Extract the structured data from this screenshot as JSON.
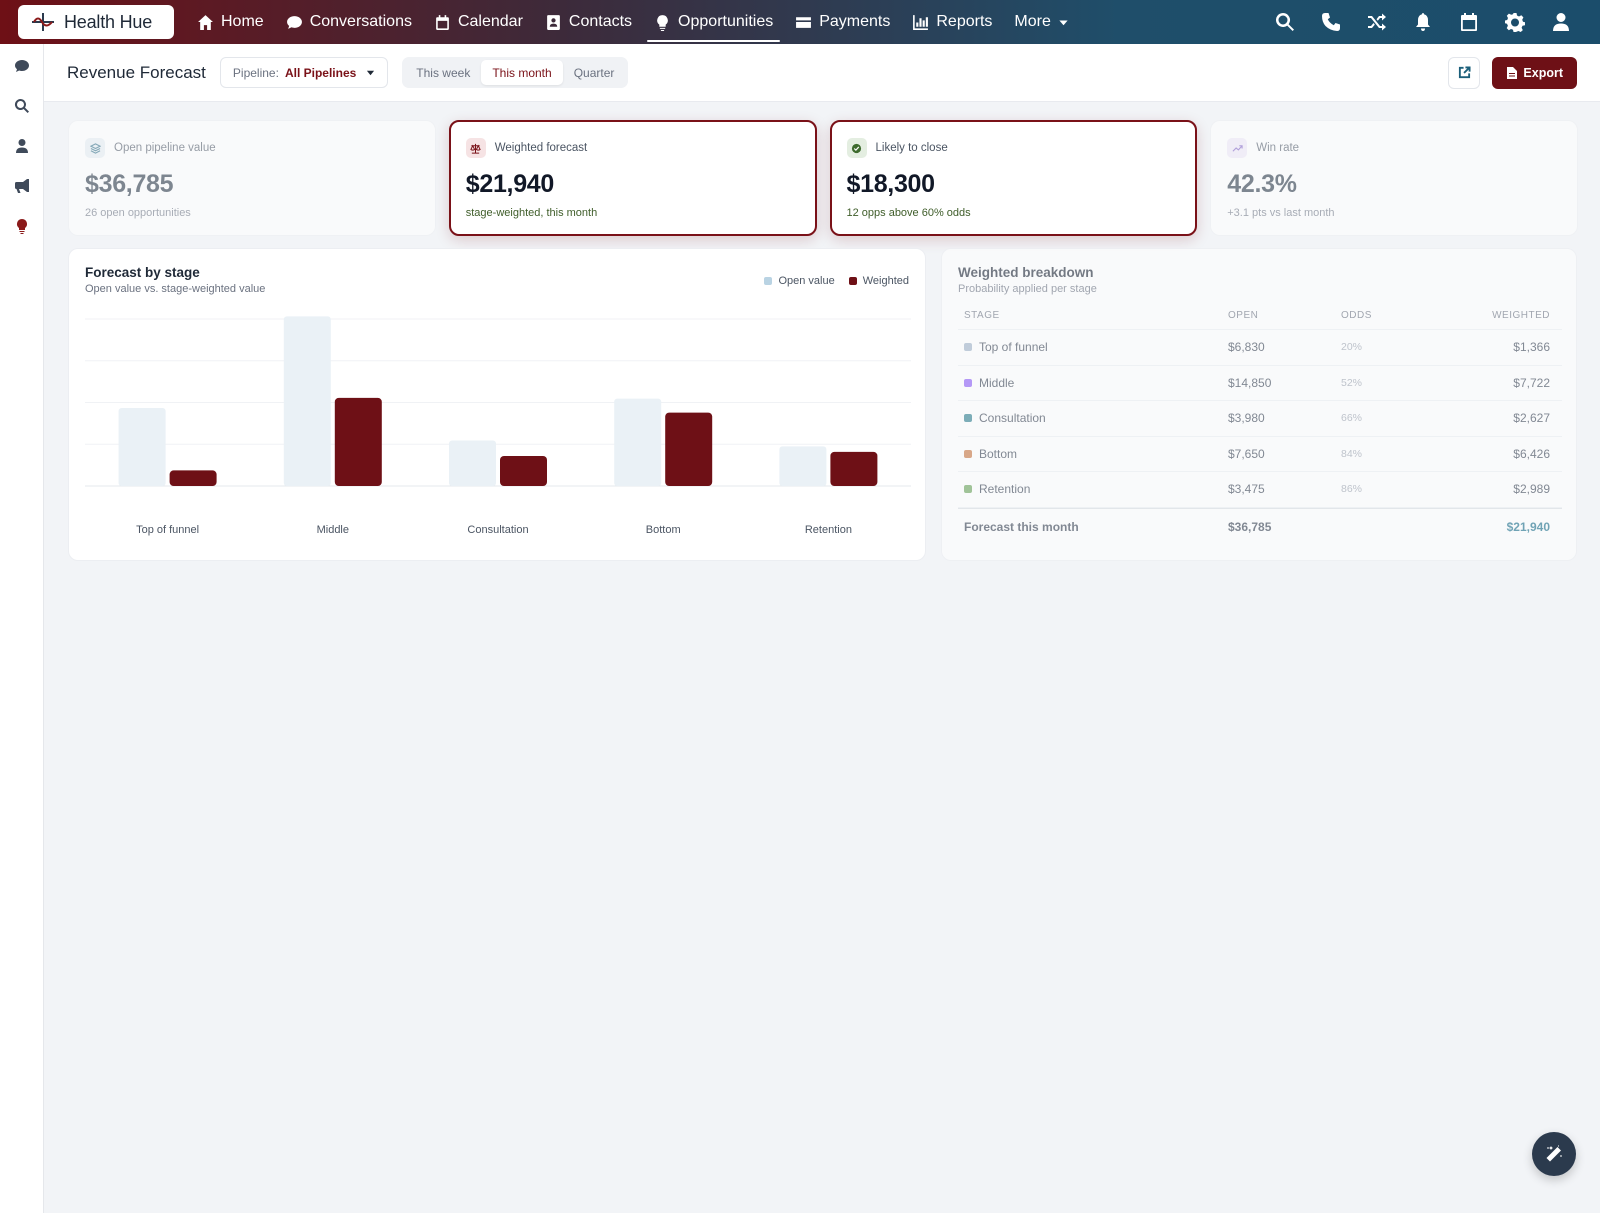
{
  "brand": {
    "name": "Health Hue"
  },
  "nav": {
    "items": [
      {
        "label": "Home",
        "icon": "home-icon"
      },
      {
        "label": "Conversations",
        "icon": "chat-icon"
      },
      {
        "label": "Calendar",
        "icon": "calendar-icon"
      },
      {
        "label": "Contacts",
        "icon": "contacts-icon"
      },
      {
        "label": "Opportunities",
        "icon": "lightbulb-icon",
        "active": true
      },
      {
        "label": "Payments",
        "icon": "credit-card-icon"
      },
      {
        "label": "Reports",
        "icon": "chart-icon"
      },
      {
        "label": "More",
        "icon": "chevron-down-icon"
      }
    ],
    "right_icons": [
      "search-icon",
      "phone-icon",
      "shuffle-icon",
      "bell-icon",
      "calendar-icon",
      "gear-icon",
      "user-icon"
    ]
  },
  "rail": {
    "icons": [
      "chat-icon",
      "search-icon",
      "user-icon",
      "megaphone-icon",
      "lightbulb-icon"
    ]
  },
  "header": {
    "title": "Revenue Forecast",
    "pipeline_label": "Pipeline:",
    "pipeline_value": "All Pipelines",
    "ranges": [
      "This week",
      "This month",
      "Quarter"
    ],
    "active_range": "This month",
    "export_label": "Export"
  },
  "kpis": [
    {
      "label": "Open pipeline value",
      "value": "$36,785",
      "sub": "26 open opportunities",
      "icon": "layers-icon"
    },
    {
      "label": "Weighted forecast",
      "value": "$21,940",
      "sub": "stage-weighted, this month",
      "icon": "scale-icon"
    },
    {
      "label": "Likely to close",
      "value": "$18,300",
      "sub": "12 opps above 60% odds",
      "icon": "check-circle-icon"
    },
    {
      "label": "Win rate",
      "value": "42.3%",
      "sub": "+3.1 pts vs last month",
      "icon": "trend-up-icon"
    }
  ],
  "chart": {
    "title": "Forecast by stage",
    "subtitle": "Open value vs. stage-weighted value",
    "legend": [
      "Open value",
      "Weighted"
    ]
  },
  "chart_data": {
    "type": "bar",
    "categories": [
      "Top of funnel",
      "Middle",
      "Consultation",
      "Bottom",
      "Retention"
    ],
    "series": [
      {
        "name": "Open value",
        "values": [
          6830,
          14850,
          3980,
          7650,
          3475
        ],
        "color": "#eaf1f6"
      },
      {
        "name": "Weighted",
        "values": [
          1366,
          7722,
          2627,
          6426,
          2989
        ],
        "color": "#6e1016"
      }
    ],
    "grid": true,
    "legend": "top-right"
  },
  "breakdown": {
    "title": "Weighted breakdown",
    "subtitle": "Probability applied per stage",
    "columns": [
      "STAGE",
      "OPEN",
      "ODDS",
      "WEIGHTED"
    ],
    "rows": [
      {
        "stage": "Top of funnel",
        "open": "$6,830",
        "odds": "20%",
        "weighted": "$1,366",
        "color": "#9fb3c8"
      },
      {
        "stage": "Middle",
        "open": "$14,850",
        "odds": "52%",
        "weighted": "$7,722",
        "color": "#8b5cf6"
      },
      {
        "stage": "Consultation",
        "open": "$3,980",
        "odds": "66%",
        "weighted": "$2,627",
        "color": "#2f7f8f"
      },
      {
        "stage": "Bottom",
        "open": "$7,650",
        "odds": "84%",
        "weighted": "$6,426",
        "color": "#c8743f"
      },
      {
        "stage": "Retention",
        "open": "$3,475",
        "odds": "86%",
        "weighted": "$2,989",
        "color": "#6aa35a"
      }
    ],
    "footer": {
      "label": "Forecast this month",
      "open": "$36,785",
      "weighted": "$21,940"
    }
  }
}
